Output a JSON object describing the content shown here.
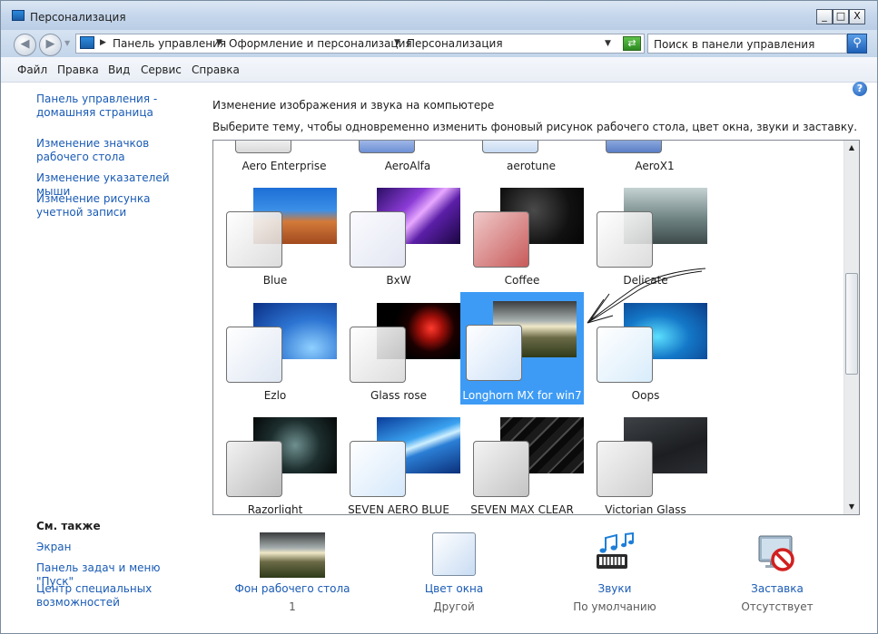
{
  "window": {
    "title": "Персонализация",
    "controls": {
      "minimize": "_",
      "maximize": "□",
      "close": "X"
    }
  },
  "address": {
    "crumbs": [
      "Панель управления",
      "Оформление и персонализация",
      "Персонализация"
    ],
    "search_placeholder": "Поиск в панели управления"
  },
  "menu": [
    "Файл",
    "Правка",
    "Вид",
    "Сервис",
    "Справка"
  ],
  "sidebar": {
    "links": [
      "Панель управления - домашняя страница",
      "Изменение значков рабочего стола",
      "Изменение указателей мыши",
      "Изменение рисунка учетной записи"
    ],
    "see_also_title": "См. также",
    "see_also": [
      "Экран",
      "Панель задач и меню \"Пуск\"",
      "Центр специальных возможностей"
    ]
  },
  "main": {
    "heading": "Изменение изображения и звука на компьютере",
    "subheading": "Выберите тему, чтобы одновременно изменить фоновый рисунок рабочего стола, цвет окна, звуки и заставку."
  },
  "themes": {
    "top_row": [
      "Aero Enterprise",
      "AeroAlfa",
      "aerotune",
      "AeroX1"
    ],
    "rows": [
      [
        "Blue",
        "BxW",
        "Coffee",
        "Delicate"
      ],
      [
        "Ezlo",
        "Glass rose",
        "Longhorn MX for win7",
        "Oops"
      ],
      [
        "Razorlight",
        "SEVEN AERO BLUE",
        "SEVEN MAX CLEAR",
        "Victorian Glass"
      ]
    ],
    "selected": "Longhorn MX for win7"
  },
  "bottom": [
    {
      "label": "Фон рабочего стола",
      "value": "1"
    },
    {
      "label": "Цвет окна",
      "value": "Другой"
    },
    {
      "label": "Звуки",
      "value": "По умолчанию"
    },
    {
      "label": "Заставка",
      "value": "Отсутствует"
    }
  ],
  "icons": {
    "back": "back-arrow-icon",
    "forward": "forward-arrow-icon",
    "search": "magnifier-icon",
    "help": "help-icon"
  }
}
